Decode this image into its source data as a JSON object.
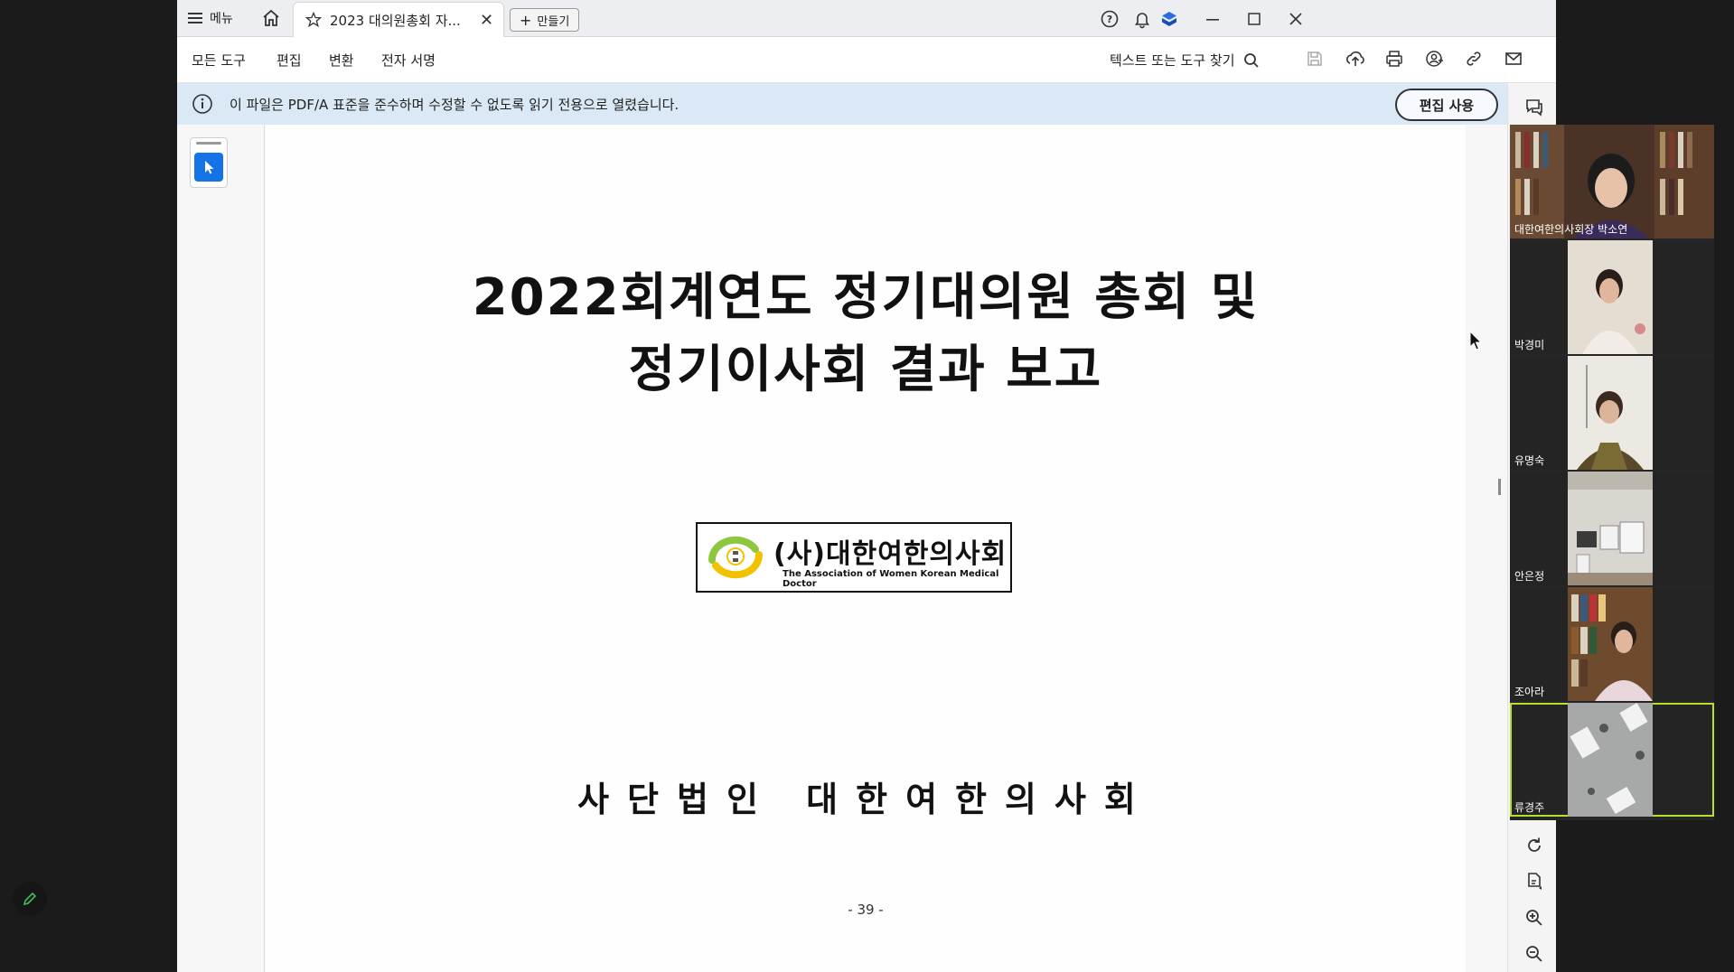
{
  "titlebar": {
    "menu_label": "메뉴",
    "tab_title": "2023 대의원총회 자...",
    "create_label": "만들기"
  },
  "toolbar": {
    "items": [
      "모든 도구",
      "편집",
      "변환",
      "전자 서명"
    ],
    "search_label": "텍스트 또는 도구 찾기"
  },
  "infobar": {
    "message": "이 파일은 PDF/A 표준을 준수하며 수정할 수 없도록 읽기 전용으로 열렸습니다.",
    "edit_button": "편집 사용"
  },
  "document": {
    "title_line1": "2022회계연도 정기대의원 총회 및",
    "title_line2": "정기이사회 결과 보고",
    "logo_korean": "(사)대한여한의사회",
    "logo_english": "The Association of Women Korean Medical Doctor",
    "organization": "사단법인 대한여한의사회",
    "page_number": "- 39 -"
  },
  "participants": [
    "대한여한의사회장 박소연",
    "박경미",
    "유명숙",
    "안은정",
    "조아라",
    "류경주"
  ],
  "colors": {
    "accent": "#1473e6",
    "infobar": "#dbe8f6",
    "active_speaker": "#b6e02b"
  }
}
